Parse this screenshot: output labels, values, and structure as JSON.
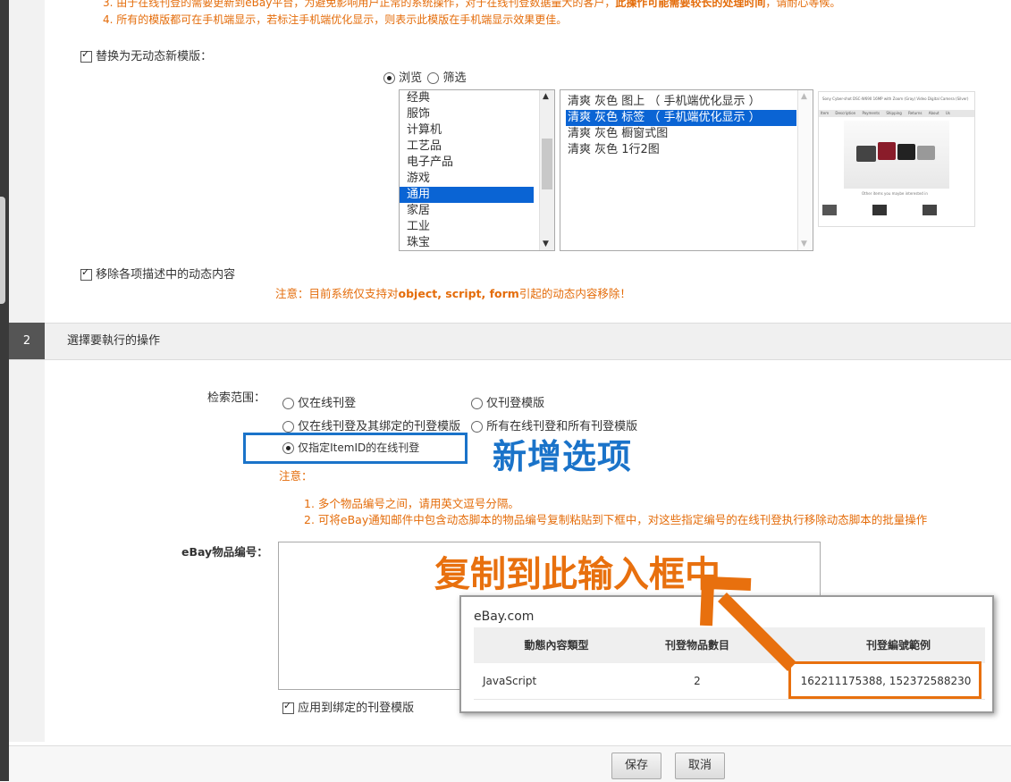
{
  "notes_top": [
    {
      "text_prefix": "3. 由于在线刊登的需要更新到eBay平台，为避免影响用户正常的系统操作，对于在线刊登数据量大的客户，",
      "text_bold": "此操作可能需要较长的处理时间",
      "text_suffix": "，请耐心等候。"
    },
    {
      "text": "4. 所有的模版都可在手机端显示，若标注手机端优化显示，则表示此模版在手机端显示效果更佳。"
    }
  ],
  "replace_template": {
    "label": "替换为无动态新模版：",
    "checked": true
  },
  "view_mode": {
    "browse": "浏览",
    "filter": "筛选",
    "selected": "browse"
  },
  "categories": {
    "items": [
      "经典",
      "服饰",
      "计算机",
      "工艺品",
      "电子产品",
      "游戏",
      "通用",
      "家居",
      "工业",
      "珠宝"
    ],
    "selected": "通用"
  },
  "templates": {
    "items": [
      "清爽 灰色 图上 （ 手机端优化显示 ）",
      "清爽 灰色 标签 （ 手机端优化显示 ）",
      "清爽 灰色 橱窗式图",
      "清爽 灰色 1行2图"
    ],
    "selected": "清爽 灰色 标签 （ 手机端优化显示 ）"
  },
  "preview": {
    "title_text": "Sony Cyber-shot DSC-W690 16MP with Zoom (Gray) Video Digital Camera (Silver)",
    "tabs": [
      "Item",
      "Description",
      "Payments",
      "Shipping",
      "Returns",
      "About Us"
    ],
    "related_text": "Other items you maybe interested in"
  },
  "remove_dynamic": {
    "label": "移除各项描述中的动态内容",
    "checked": true
  },
  "remove_note": {
    "prefix": "注意：目前系统仅支持对",
    "bold": "object, script, form",
    "suffix": "引起的动态内容移除！"
  },
  "section2": {
    "number": "2",
    "title": "選擇要執行的操作"
  },
  "scope": {
    "label": "检索范围：",
    "options": [
      "仅在线刊登",
      "仅刊登模版",
      "仅在线刊登及其绑定的刊登模版",
      "所有在线刊登和所有刊登模版",
      "仅指定ItemID的在线刊登"
    ],
    "selected": "仅指定ItemID的在线刊登"
  },
  "annotation_new": "新增选项",
  "attention": {
    "label": "注意：",
    "items": [
      "1. 多个物品编号之间，请用英文逗号分隔。",
      "2. 可将eBay通知邮件中包含动态脚本的物品编号复制粘贴到下框中，对这些指定编号的在线刊登执行移除动态脚本的批量操作"
    ]
  },
  "item_id_field": {
    "label": "eBay物品编号：",
    "value": ""
  },
  "apply_binding": {
    "label": "应用到绑定的刊登模版",
    "checked": true
  },
  "annotation_copy": "复制到此输入框中",
  "ebay_popup": {
    "site": "eBay.com",
    "headers": [
      "動態內容類型",
      "刊登物品數目",
      "刊登編號範例"
    ],
    "row": [
      "JavaScript",
      "2",
      "162211175388, 152372588230"
    ]
  },
  "buttons": {
    "save": "保存",
    "cancel": "取消"
  },
  "colors": {
    "orange_note": "#e46c0a",
    "blue_box": "#1a73c9",
    "selection_blue": "#0a64d4",
    "arrow_orange": "#e8700e"
  }
}
